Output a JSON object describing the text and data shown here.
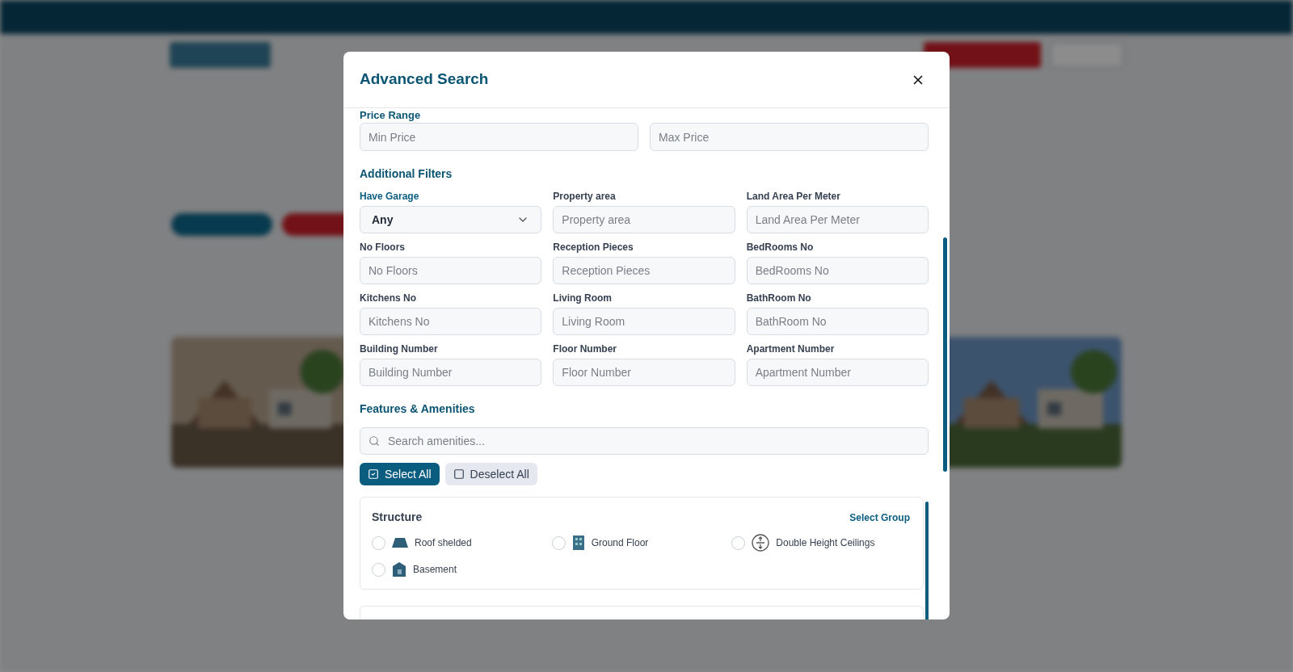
{
  "modal": {
    "title": "Advanced Search",
    "price": {
      "heading": "Price Range",
      "fields": [
        {
          "placeholder": "Min Price"
        },
        {
          "placeholder": "Max Price"
        }
      ]
    },
    "additional": {
      "heading": "Additional Filters",
      "fields": [
        {
          "kind": "select",
          "label": "Have Garage",
          "value": "Any",
          "active": true
        },
        {
          "kind": "input",
          "label": "Property area",
          "placeholder": "Property area",
          "active": false
        },
        {
          "kind": "input",
          "label": "Land Area Per Meter",
          "placeholder": "Land Area Per Meter",
          "active": false
        },
        {
          "kind": "input",
          "label": "No Floors",
          "placeholder": "No Floors",
          "active": false
        },
        {
          "kind": "input",
          "label": "Reception Pieces",
          "placeholder": "Reception Pieces",
          "active": false
        },
        {
          "kind": "input",
          "label": "BedRooms No",
          "placeholder": "BedRooms No",
          "active": false
        },
        {
          "kind": "input",
          "label": "Kitchens No",
          "placeholder": "Kitchens No",
          "active": false
        },
        {
          "kind": "input",
          "label": "Living Room",
          "placeholder": "Living Room",
          "active": false
        },
        {
          "kind": "input",
          "label": "BathRoom No",
          "placeholder": "BathRoom No",
          "active": false
        },
        {
          "kind": "input",
          "label": "Building Number",
          "placeholder": "Building Number",
          "active": false
        },
        {
          "kind": "input",
          "label": "Floor Number",
          "placeholder": "Floor Number",
          "active": false
        },
        {
          "kind": "input",
          "label": "Apartment Number",
          "placeholder": "Apartment Number",
          "active": false
        }
      ]
    },
    "amenities": {
      "heading": "Features & Amenities",
      "search_placeholder": "Search amenities...",
      "select_all": "Select All",
      "deselect_all": "Deselect All",
      "groups": [
        {
          "name": "Structure",
          "action": "Select Group",
          "items": [
            {
              "label": "Roof shelded",
              "checked": false
            },
            {
              "label": "Ground Floor",
              "checked": false
            },
            {
              "label": "Double Height Ceilings",
              "checked": false
            },
            {
              "label": "Basement",
              "checked": false
            }
          ]
        }
      ]
    }
  }
}
